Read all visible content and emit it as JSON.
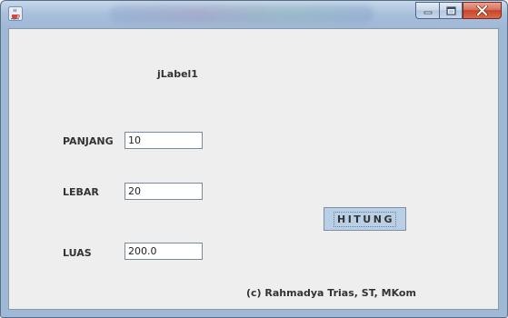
{
  "window": {
    "title": "",
    "controls": {
      "minimize": "minimize",
      "maximize": "maximize",
      "close": "close"
    }
  },
  "form": {
    "header_label": "jLabel1",
    "panjang": {
      "label": "PANJANG",
      "value": "10"
    },
    "lebar": {
      "label": "LEBAR",
      "value": "20"
    },
    "luas": {
      "label": "LUAS",
      "value": "200.0"
    },
    "hitung_button": "HITUNG",
    "credit": "(c) Rahmadya Trias, ST, MKom"
  },
  "icons": {
    "app": "java-cup-icon",
    "minimize": "minimize-icon",
    "maximize": "maximize-icon",
    "close": "close-icon"
  },
  "colors": {
    "client_background": "#eeeeee",
    "button_background": "#b8cfe5",
    "close_button": "#c7452a"
  }
}
